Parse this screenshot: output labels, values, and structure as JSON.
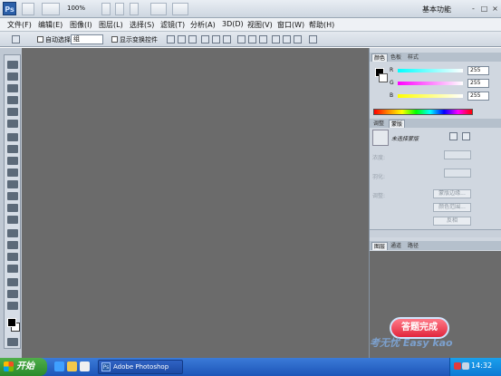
{
  "appbar": {
    "logo": "Ps",
    "zoom": "100%",
    "workspace": "基本功能",
    "controls": [
      "-",
      "□",
      "×"
    ]
  },
  "menu": [
    "文件(F)",
    "编辑(E)",
    "图像(I)",
    "图层(L)",
    "选择(S)",
    "滤镜(T)",
    "分析(A)",
    "3D(D)",
    "视图(V)",
    "窗口(W)",
    "帮助(H)"
  ],
  "options": {
    "auto_select_label": "自动选择:",
    "auto_select_value": "组",
    "show_transform_label": "显示变换控件"
  },
  "color_panel": {
    "tabs": [
      "颜色",
      "色板",
      "样式"
    ],
    "channels": [
      {
        "name": "R",
        "value": "255",
        "color": "#3ed6d6"
      },
      {
        "name": "G",
        "value": "255",
        "color": "#d63ed6"
      },
      {
        "name": "B",
        "value": "255",
        "color": "#3e6ed6"
      }
    ]
  },
  "adjust_panel": {
    "tabs": [
      "调整",
      "蒙版"
    ],
    "title": "未选择蒙版",
    "density_label": "浓度:",
    "feather_label": "羽化:",
    "refine_label": "调整:",
    "buttons": [
      "蒙版边缘...",
      "颜色范围...",
      "反相"
    ]
  },
  "layers_panel": {
    "tabs": [
      "图层",
      "通道",
      "路径"
    ]
  },
  "watermark": {
    "badge": "答题完成",
    "text": "考无忧 Easy kao"
  },
  "taskbar": {
    "start": "开始",
    "task": "Adobe Photoshop",
    "clock": "14:32"
  }
}
